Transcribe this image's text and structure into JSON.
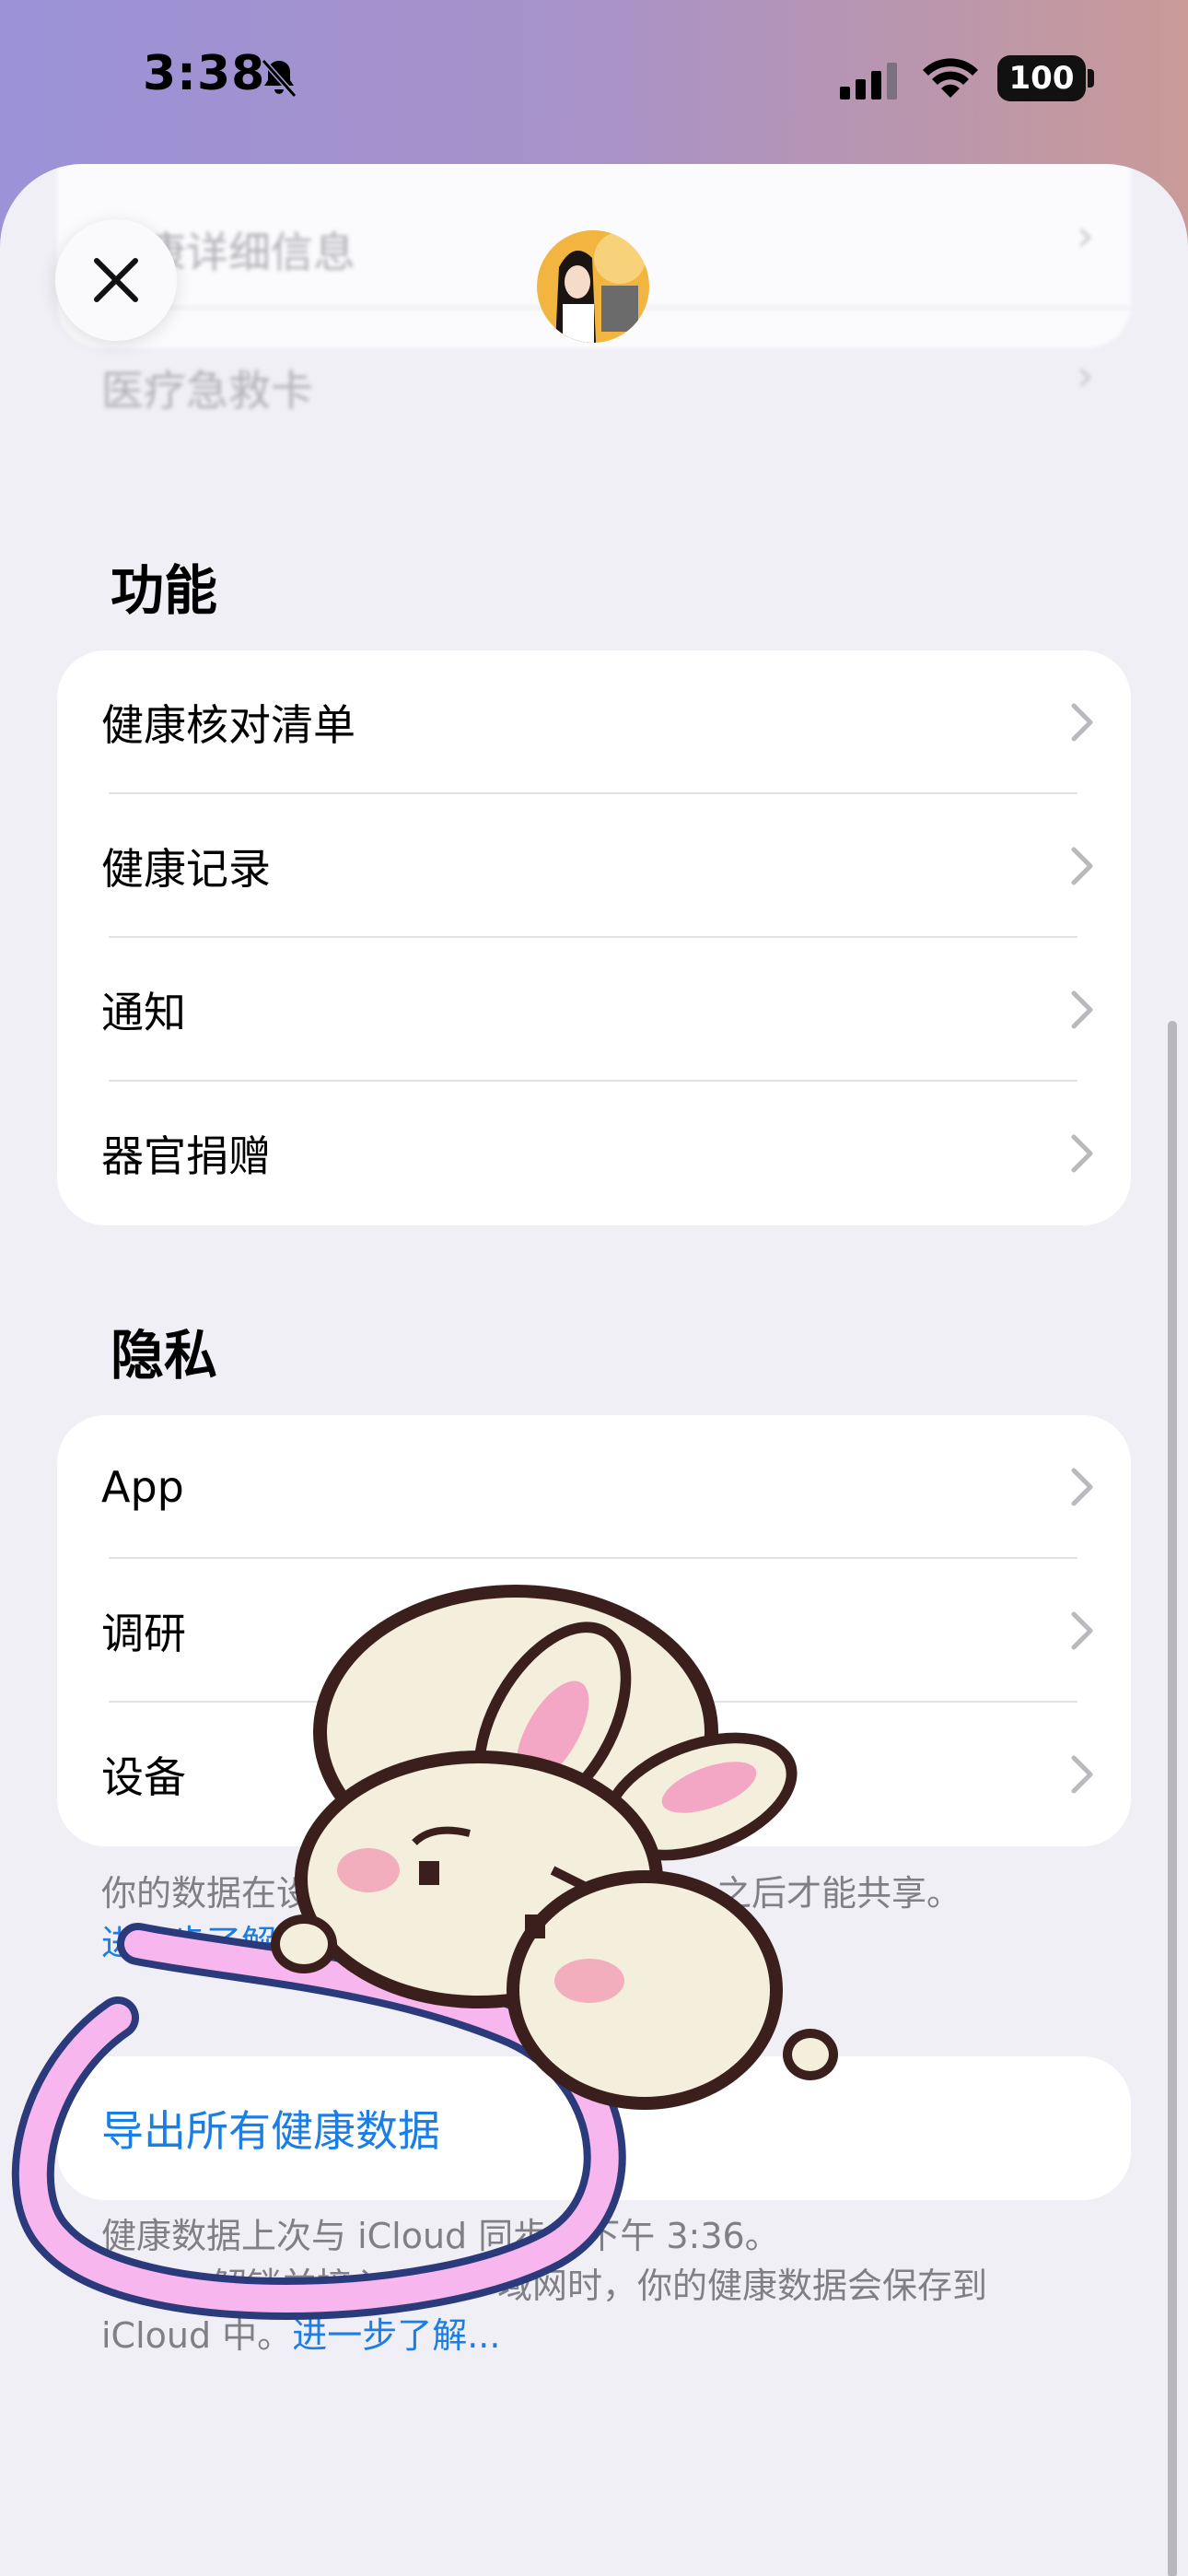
{
  "status_bar": {
    "time": "3:38",
    "battery": "100",
    "icons": [
      "bell-slash-icon",
      "signal-icon",
      "wifi-icon",
      "battery-icon"
    ]
  },
  "top_card": {
    "rows": [
      {
        "label": "健康详细信息"
      },
      {
        "label": "医疗急救卡"
      }
    ]
  },
  "features": {
    "title": "功能",
    "items": [
      {
        "label": "健康核对清单"
      },
      {
        "label": "健康记录"
      },
      {
        "label": "通知"
      },
      {
        "label": "器官捐赠"
      }
    ]
  },
  "privacy": {
    "title": "隐私",
    "items": [
      {
        "label": "App"
      },
      {
        "label": "调研"
      },
      {
        "label": "设备"
      }
    ],
    "footnote_visible": "你的数据在设",
    "footnote_end": "之后才能共享。",
    "learn_more": "进一步了解..."
  },
  "export": {
    "label": "导出所有健康数据",
    "footnote_line1_a": "健康数据上次与 iCloud 同步",
    "footnote_line1_b": "下午 3:36。",
    "footnote_line2": "解锁并接入",
    "footnote_line2_b": "域网时，你的健康数据会保存到",
    "footnote_line3": "iCloud 中。",
    "learn_more": "进一步了解..."
  },
  "colors": {
    "accent": "#1b7de6",
    "background": "#f0eff5"
  }
}
